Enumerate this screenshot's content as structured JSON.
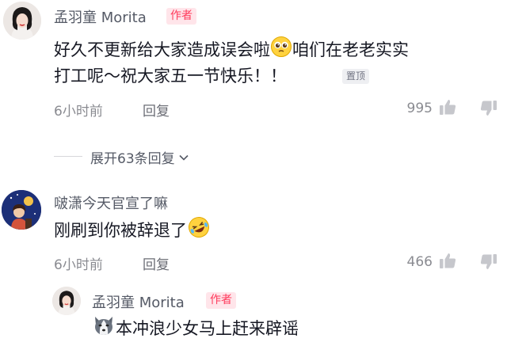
{
  "comment1": {
    "author": "孟羽童 Morita",
    "author_badge": "作者",
    "text_line1_a": "好久不更新给大家造成误会啦",
    "text_line1_b": "咱们在老老实实",
    "text_line2": "打工呢～祝大家五一节快乐！！",
    "pinned_label": "置顶",
    "time": "6小时前",
    "reply_label": "回复",
    "likes": "995"
  },
  "expand_replies": {
    "label": "展开63条回复"
  },
  "comment2": {
    "author": "啵潇今天官宣了嘛",
    "text": "刚刷到你被辞退了",
    "time": "6小时前",
    "reply_label": "回复",
    "likes": "466"
  },
  "reply1": {
    "author": "孟羽童 Morita",
    "author_badge": "作者",
    "text": "本冲浪少女马上赶来辟谣"
  },
  "colors": {
    "author_badge": "#ff3b5c",
    "badge_bg": "#ffe5ea",
    "meta": "#8a8b91"
  }
}
